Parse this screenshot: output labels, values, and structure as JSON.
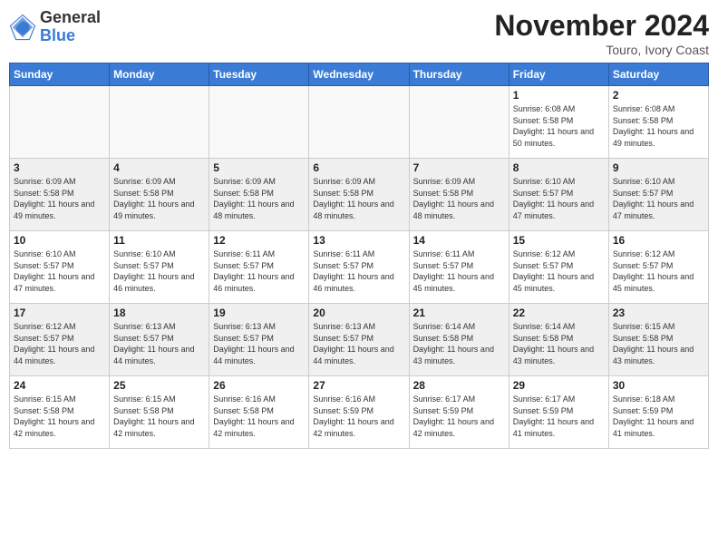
{
  "logo": {
    "general": "General",
    "blue": "Blue"
  },
  "title": "November 2024",
  "subtitle": "Touro, Ivory Coast",
  "headers": [
    "Sunday",
    "Monday",
    "Tuesday",
    "Wednesday",
    "Thursday",
    "Friday",
    "Saturday"
  ],
  "weeks": [
    [
      {
        "day": "",
        "info": ""
      },
      {
        "day": "",
        "info": ""
      },
      {
        "day": "",
        "info": ""
      },
      {
        "day": "",
        "info": ""
      },
      {
        "day": "",
        "info": ""
      },
      {
        "day": "1",
        "info": "Sunrise: 6:08 AM\nSunset: 5:58 PM\nDaylight: 11 hours and 50 minutes."
      },
      {
        "day": "2",
        "info": "Sunrise: 6:08 AM\nSunset: 5:58 PM\nDaylight: 11 hours and 49 minutes."
      }
    ],
    [
      {
        "day": "3",
        "info": "Sunrise: 6:09 AM\nSunset: 5:58 PM\nDaylight: 11 hours and 49 minutes."
      },
      {
        "day": "4",
        "info": "Sunrise: 6:09 AM\nSunset: 5:58 PM\nDaylight: 11 hours and 49 minutes."
      },
      {
        "day": "5",
        "info": "Sunrise: 6:09 AM\nSunset: 5:58 PM\nDaylight: 11 hours and 48 minutes."
      },
      {
        "day": "6",
        "info": "Sunrise: 6:09 AM\nSunset: 5:58 PM\nDaylight: 11 hours and 48 minutes."
      },
      {
        "day": "7",
        "info": "Sunrise: 6:09 AM\nSunset: 5:58 PM\nDaylight: 11 hours and 48 minutes."
      },
      {
        "day": "8",
        "info": "Sunrise: 6:10 AM\nSunset: 5:57 PM\nDaylight: 11 hours and 47 minutes."
      },
      {
        "day": "9",
        "info": "Sunrise: 6:10 AM\nSunset: 5:57 PM\nDaylight: 11 hours and 47 minutes."
      }
    ],
    [
      {
        "day": "10",
        "info": "Sunrise: 6:10 AM\nSunset: 5:57 PM\nDaylight: 11 hours and 47 minutes."
      },
      {
        "day": "11",
        "info": "Sunrise: 6:10 AM\nSunset: 5:57 PM\nDaylight: 11 hours and 46 minutes."
      },
      {
        "day": "12",
        "info": "Sunrise: 6:11 AM\nSunset: 5:57 PM\nDaylight: 11 hours and 46 minutes."
      },
      {
        "day": "13",
        "info": "Sunrise: 6:11 AM\nSunset: 5:57 PM\nDaylight: 11 hours and 46 minutes."
      },
      {
        "day": "14",
        "info": "Sunrise: 6:11 AM\nSunset: 5:57 PM\nDaylight: 11 hours and 45 minutes."
      },
      {
        "day": "15",
        "info": "Sunrise: 6:12 AM\nSunset: 5:57 PM\nDaylight: 11 hours and 45 minutes."
      },
      {
        "day": "16",
        "info": "Sunrise: 6:12 AM\nSunset: 5:57 PM\nDaylight: 11 hours and 45 minutes."
      }
    ],
    [
      {
        "day": "17",
        "info": "Sunrise: 6:12 AM\nSunset: 5:57 PM\nDaylight: 11 hours and 44 minutes."
      },
      {
        "day": "18",
        "info": "Sunrise: 6:13 AM\nSunset: 5:57 PM\nDaylight: 11 hours and 44 minutes."
      },
      {
        "day": "19",
        "info": "Sunrise: 6:13 AM\nSunset: 5:57 PM\nDaylight: 11 hours and 44 minutes."
      },
      {
        "day": "20",
        "info": "Sunrise: 6:13 AM\nSunset: 5:57 PM\nDaylight: 11 hours and 44 minutes."
      },
      {
        "day": "21",
        "info": "Sunrise: 6:14 AM\nSunset: 5:58 PM\nDaylight: 11 hours and 43 minutes."
      },
      {
        "day": "22",
        "info": "Sunrise: 6:14 AM\nSunset: 5:58 PM\nDaylight: 11 hours and 43 minutes."
      },
      {
        "day": "23",
        "info": "Sunrise: 6:15 AM\nSunset: 5:58 PM\nDaylight: 11 hours and 43 minutes."
      }
    ],
    [
      {
        "day": "24",
        "info": "Sunrise: 6:15 AM\nSunset: 5:58 PM\nDaylight: 11 hours and 42 minutes."
      },
      {
        "day": "25",
        "info": "Sunrise: 6:15 AM\nSunset: 5:58 PM\nDaylight: 11 hours and 42 minutes."
      },
      {
        "day": "26",
        "info": "Sunrise: 6:16 AM\nSunset: 5:58 PM\nDaylight: 11 hours and 42 minutes."
      },
      {
        "day": "27",
        "info": "Sunrise: 6:16 AM\nSunset: 5:59 PM\nDaylight: 11 hours and 42 minutes."
      },
      {
        "day": "28",
        "info": "Sunrise: 6:17 AM\nSunset: 5:59 PM\nDaylight: 11 hours and 42 minutes."
      },
      {
        "day": "29",
        "info": "Sunrise: 6:17 AM\nSunset: 5:59 PM\nDaylight: 11 hours and 41 minutes."
      },
      {
        "day": "30",
        "info": "Sunrise: 6:18 AM\nSunset: 5:59 PM\nDaylight: 11 hours and 41 minutes."
      }
    ]
  ]
}
